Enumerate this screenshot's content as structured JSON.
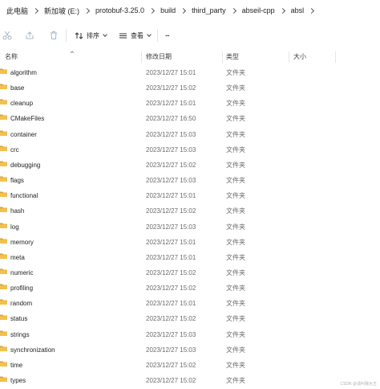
{
  "breadcrumb": [
    "此电脑",
    "新加坡 (E:)",
    "protobuf-3.25.0",
    "build",
    "third_party",
    "abseil-cpp",
    "absl"
  ],
  "toolbar": {
    "sort_label": "排序",
    "view_label": "查看",
    "more_label": "···"
  },
  "columns": {
    "name": "名称",
    "modified": "修改日期",
    "type": "类型",
    "size": "大小"
  },
  "rows": [
    {
      "name": "algorithm",
      "modified": "2023/12/27 15:01",
      "type": "文件夹"
    },
    {
      "name": "base",
      "modified": "2023/12/27 15:02",
      "type": "文件夹"
    },
    {
      "name": "cleanup",
      "modified": "2023/12/27 15:01",
      "type": "文件夹"
    },
    {
      "name": "CMakeFiles",
      "modified": "2023/12/27 16:50",
      "type": "文件夹"
    },
    {
      "name": "container",
      "modified": "2023/12/27 15:03",
      "type": "文件夹"
    },
    {
      "name": "crc",
      "modified": "2023/12/27 15:03",
      "type": "文件夹"
    },
    {
      "name": "debugging",
      "modified": "2023/12/27 15:02",
      "type": "文件夹"
    },
    {
      "name": "flags",
      "modified": "2023/12/27 15:03",
      "type": "文件夹"
    },
    {
      "name": "functional",
      "modified": "2023/12/27 15:01",
      "type": "文件夹"
    },
    {
      "name": "hash",
      "modified": "2023/12/27 15:02",
      "type": "文件夹"
    },
    {
      "name": "log",
      "modified": "2023/12/27 15:03",
      "type": "文件夹"
    },
    {
      "name": "memory",
      "modified": "2023/12/27 15:01",
      "type": "文件夹"
    },
    {
      "name": "meta",
      "modified": "2023/12/27 15:01",
      "type": "文件夹"
    },
    {
      "name": "numeric",
      "modified": "2023/12/27 15:02",
      "type": "文件夹"
    },
    {
      "name": "profiling",
      "modified": "2023/12/27 15:02",
      "type": "文件夹"
    },
    {
      "name": "random",
      "modified": "2023/12/27 15:01",
      "type": "文件夹"
    },
    {
      "name": "status",
      "modified": "2023/12/27 15:02",
      "type": "文件夹"
    },
    {
      "name": "strings",
      "modified": "2023/12/27 15:03",
      "type": "文件夹"
    },
    {
      "name": "synchronization",
      "modified": "2023/12/27 15:03",
      "type": "文件夹"
    },
    {
      "name": "time",
      "modified": "2023/12/27 15:02",
      "type": "文件夹"
    },
    {
      "name": "types",
      "modified": "2023/12/27 15:02",
      "type": "文件夹"
    }
  ],
  "watermark": "CSDN @请叫我大王",
  "colors": {
    "folder": "#f2c14e",
    "folder_dark": "#dca233",
    "text": "#1f1f1f",
    "muted": "#6b6b6b",
    "disabled_icon": "#a9b7c6"
  },
  "icons": {
    "cut": "scissors-icon",
    "share": "share-icon",
    "delete": "trash-icon",
    "sort": "sort-icon",
    "view": "view-icon",
    "folder": "folder-icon"
  }
}
